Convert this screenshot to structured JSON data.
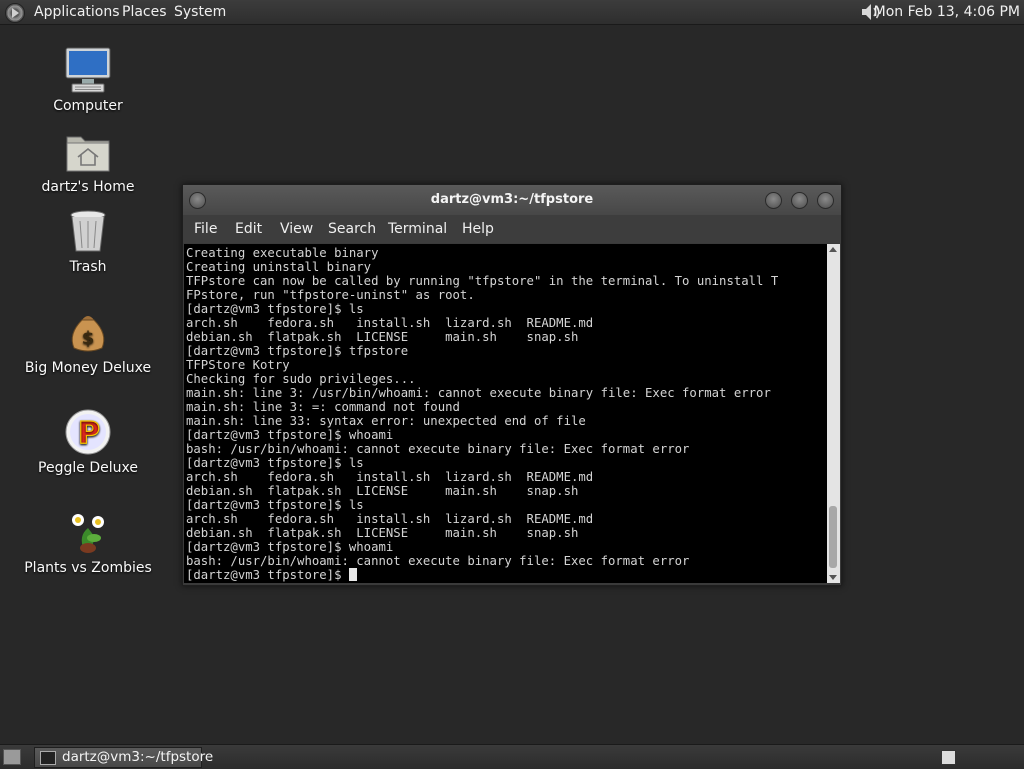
{
  "top_panel": {
    "menus": [
      "Applications",
      "Places",
      "System"
    ],
    "clock": "Mon Feb 13,  4:06 PM",
    "icons": [
      "distro-logo-icon",
      "volume-icon"
    ]
  },
  "desktop": {
    "icons": [
      {
        "label": "Computer",
        "icon": "computer-monitor-icon"
      },
      {
        "label": "dartz's Home",
        "icon": "home-folder-icon"
      },
      {
        "label": "Trash",
        "icon": "trash-can-icon"
      },
      {
        "label": "Big Money Deluxe",
        "icon": "money-bag-icon"
      },
      {
        "label": "Peggle Deluxe",
        "icon": "peggle-logo-icon"
      },
      {
        "label": "Plants vs Zombies",
        "icon": "plants-flower-icon"
      }
    ]
  },
  "window": {
    "title": "dartz@vm3:~/tfpstore",
    "menu": [
      "File",
      "Edit",
      "View",
      "Search",
      "Terminal",
      "Help"
    ],
    "terminal_lines": [
      "Creating executable binary",
      "Creating uninstall binary",
      "TFPstore can now be called by running \"tfpstore\" in the terminal. To uninstall T",
      "FPstore, run \"tfpstore-uninst\" as root.",
      "[dartz@vm3 tfpstore]$ ls",
      "arch.sh    fedora.sh   install.sh  lizard.sh  README.md",
      "debian.sh  flatpak.sh  LICENSE     main.sh    snap.sh",
      "[dartz@vm3 tfpstore]$ tfpstore",
      "TFPStore Kotry",
      "Checking for sudo privileges...",
      "main.sh: line 3: /usr/bin/whoami: cannot execute binary file: Exec format error",
      "main.sh: line 3: =: command not found",
      "main.sh: line 33: syntax error: unexpected end of file",
      "[dartz@vm3 tfpstore]$ whoami",
      "bash: /usr/bin/whoami: cannot execute binary file: Exec format error",
      "[dartz@vm3 tfpstore]$ ls",
      "arch.sh    fedora.sh   install.sh  lizard.sh  README.md",
      "debian.sh  flatpak.sh  LICENSE     main.sh    snap.sh",
      "[dartz@vm3 tfpstore]$ ls",
      "arch.sh    fedora.sh   install.sh  lizard.sh  README.md",
      "debian.sh  flatpak.sh  LICENSE     main.sh    snap.sh",
      "[dartz@vm3 tfpstore]$ whoami",
      "bash: /usr/bin/whoami: cannot execute binary file: Exec format error"
    ],
    "prompt": "[dartz@vm3 tfpstore]$ "
  },
  "taskbar": {
    "task_label": "dartz@vm3:~/tfpstore"
  },
  "colors": {
    "desktop_bg": "#282828",
    "panel_bg": "#333333",
    "terminal_bg": "#000000",
    "terminal_fg": "#d4d4d4"
  }
}
